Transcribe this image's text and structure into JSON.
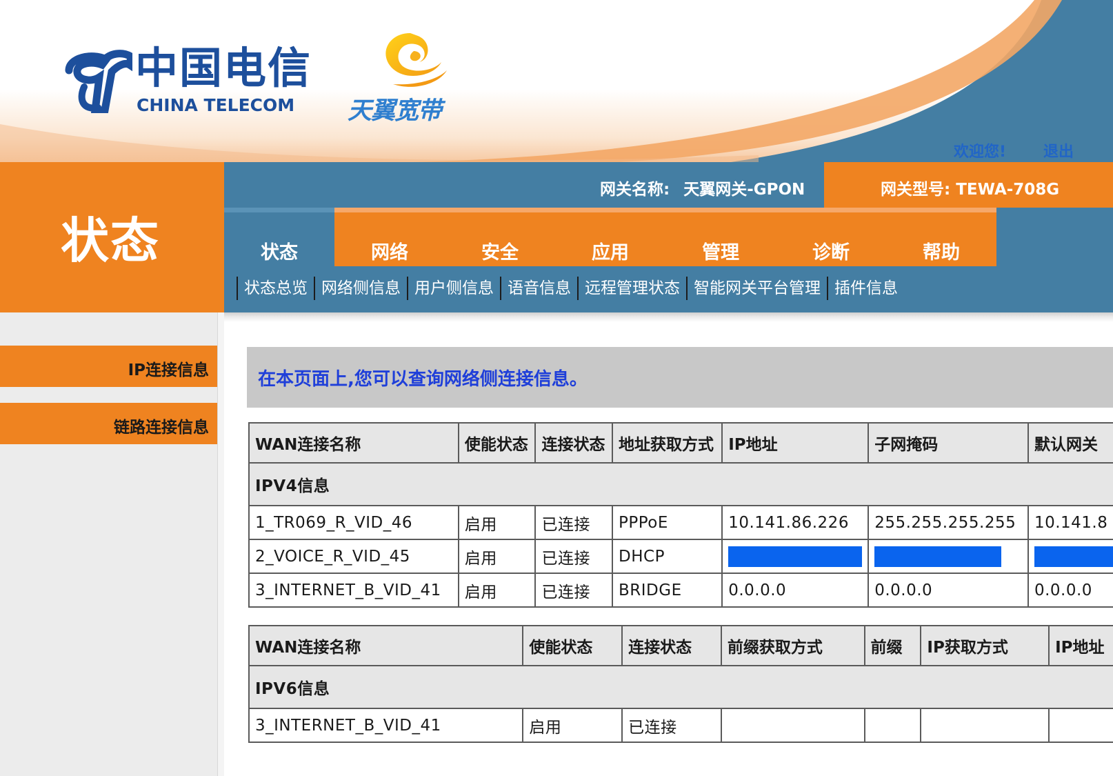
{
  "brand": {
    "name_cn": "中国电信",
    "name_en": "CHINA TELECOM",
    "product": "天翼宽带"
  },
  "user": {
    "welcome": "欢迎您!",
    "logout": "退出"
  },
  "gateway": {
    "name_label": "网关名称:",
    "name_value": "天翼网关-GPON",
    "model_label": "网关型号:",
    "model_value": "TEWA-708G"
  },
  "section_title": "状态",
  "tabs": [
    {
      "label": "状态",
      "active": true
    },
    {
      "label": "网络",
      "active": false
    },
    {
      "label": "安全",
      "active": false
    },
    {
      "label": "应用",
      "active": false
    },
    {
      "label": "管理",
      "active": false
    },
    {
      "label": "诊断",
      "active": false
    },
    {
      "label": "帮助",
      "active": false
    }
  ],
  "subnav": [
    {
      "label": "状态总览"
    },
    {
      "label": "网络侧信息"
    },
    {
      "label": "用户侧信息"
    },
    {
      "label": "语音信息"
    },
    {
      "label": "远程管理状态"
    },
    {
      "label": "智能网关平台管理"
    },
    {
      "label": "插件信息"
    }
  ],
  "sidebar": [
    {
      "label": "IP连接信息"
    },
    {
      "label": "链路连接信息"
    }
  ],
  "notice": "在本页面上,您可以查询网络侧连接信息。",
  "ipv4": {
    "title": "IPV4信息",
    "headers": [
      "WAN连接名称",
      "使能状态",
      "连接状态",
      "地址获取方式",
      "IP地址",
      "子网掩码",
      "默认网关"
    ],
    "rows": [
      [
        "1_TR069_R_VID_46",
        "启用",
        "已连接",
        "PPPoE",
        "10.141.86.226",
        "255.255.255.255",
        "10.141.8"
      ],
      [
        "2_VOICE_R_VID_45",
        "启用",
        "已连接",
        "DHCP",
        "",
        "",
        ""
      ],
      [
        "3_INTERNET_B_VID_41",
        "启用",
        "已连接",
        "BRIDGE",
        "0.0.0.0",
        "0.0.0.0",
        "0.0.0.0"
      ]
    ]
  },
  "ipv6": {
    "title": "IPV6信息",
    "headers": [
      "WAN连接名称",
      "使能状态",
      "连接状态",
      "前缀获取方式",
      "前缀",
      "IP获取方式",
      "IP地址"
    ],
    "rows": [
      [
        "3_INTERNET_B_VID_41",
        "启用",
        "已连接",
        "",
        "",
        "",
        ""
      ]
    ]
  },
  "colors": {
    "orange": "#ef8320",
    "blue": "#447ea3",
    "brand_blue": "#1d4f9c",
    "notice_text": "#1f3fd9",
    "mask": "#0a64ee"
  }
}
